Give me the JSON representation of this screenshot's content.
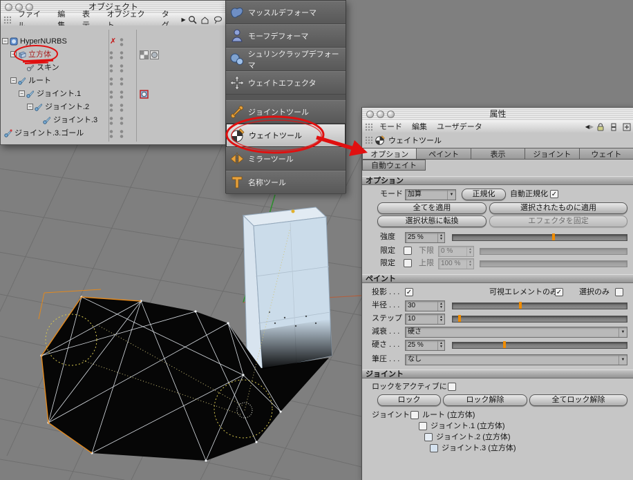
{
  "icons": {
    "minus": "−",
    "check": "✓",
    "close_x": "✗",
    "up": "▲",
    "down": "▼",
    "dropdown": "▼",
    "back": "◀",
    "forward": "▶"
  },
  "colors": {
    "accent_orange": "#f08c00",
    "annotation_red": "#e01010",
    "viewport_bg": "#7f7f7f",
    "box_blue": "#cbdcea",
    "selected_label": "#aa2222"
  },
  "object_manager": {
    "title": "オブジェクト",
    "menus": [
      "ファイル",
      "編集",
      "表示",
      "オブジェクト",
      "タグ"
    ],
    "tree": [
      "HyperNURBS",
      "立方体",
      "スキン",
      "ルート",
      "ジョイント.1",
      "ジョイント.2",
      "ジョイント.3",
      "ジョイント.3.ゴール"
    ]
  },
  "tool_palette": {
    "items": [
      "マッスルデフォーマ",
      "モーフデフォーマ",
      "シュリンクラップデフォーマ",
      "ウェイトエフェクタ",
      "ジョイントツール",
      "ウェイトツール",
      "ミラーツール",
      "名称ツール"
    ]
  },
  "attributes": {
    "title": "属性",
    "menus": [
      "モード",
      "編集",
      "ユーザデータ"
    ],
    "tool_name": "ウェイトツール",
    "tabs": [
      "オプション",
      "ペイント",
      "表示",
      "ジョイント",
      "ウェイト"
    ],
    "tab_auto": "自動ウェイト",
    "options": {
      "section": "オプション",
      "mode_label": "モード",
      "mode_value": "加算",
      "normalize": "正規化",
      "auto_normalize_label": "自動正規化",
      "apply_all": "全てを適用",
      "apply_selected": "選択されたものに適用",
      "convert_selection": "選択状態に転換",
      "fix_effector": "エフェクタを固定",
      "strength_label": "強度",
      "strength_value": "25 %",
      "limit_label": "限定",
      "lower_label": "下限",
      "lower_value": "0 %",
      "upper_label": "上限",
      "upper_value": "100 %"
    },
    "paint": {
      "section": "ペイント",
      "projection_label": "投影 . . .",
      "visible_only_label": "可視エレメントのみ",
      "selected_only_label": "選択のみ",
      "radius_label": "半径 . . .",
      "radius_value": "30",
      "step_label": "ステップ",
      "step_value": "10",
      "falloff_label": "減衰 . . .",
      "falloff_value": "硬さ",
      "hardness_label": "硬さ . . .",
      "hardness_value": "25 %",
      "pressure_label": "筆圧 . . .",
      "pressure_value": "なし"
    },
    "joints": {
      "section": "ジョイント",
      "lock_active_label": "ロックをアクティブに",
      "lock": "ロック",
      "unlock": "ロック解除",
      "unlock_all": "全てロック解除",
      "list_label": "ジョイント",
      "items": [
        "ルート (立方体)",
        "ジョイント.1 (立方体)",
        "ジョイント.2 (立方体)",
        "ジョイント.3 (立方体)"
      ],
      "tints": [
        "#f3f3f3",
        "#f3f3f3",
        "#e6edf4",
        "#d5e2ef"
      ]
    },
    "sliders": {
      "strength_pct": 57,
      "radius_pct": 38,
      "step_pct": 3,
      "hardness_pct": 29
    },
    "checks": {
      "auto_normalize": true,
      "projection": true,
      "visible_only": true,
      "selected_only": false,
      "limit_lower": false,
      "limit_upper": false,
      "lock_active": false,
      "joint_0": false,
      "joint_1": false,
      "joint_2": false,
      "joint_3": false
    }
  }
}
